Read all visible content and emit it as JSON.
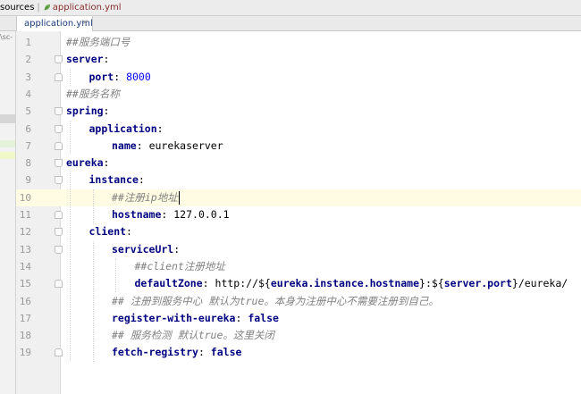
{
  "breadcrumb": {
    "items": [
      "sources",
      "application.yml"
    ]
  },
  "tab": {
    "label": "application.yml",
    "close": "×",
    "icon": "yml-leaf-icon"
  },
  "side_panel": {
    "path_text": "\\sc-"
  },
  "colors": {
    "key": "#000080",
    "comment": "#808080",
    "number": "#0000ff",
    "current_line": "#fffce3"
  },
  "editor": {
    "current_line": 10,
    "lines": [
      {
        "n": "1",
        "indent": 0,
        "parts": [
          {
            "t": "cmt",
            "v": "##服务端口号"
          }
        ]
      },
      {
        "n": "2",
        "indent": 0,
        "parts": [
          {
            "t": "key",
            "v": "server"
          },
          {
            "t": "punct",
            "v": ":"
          }
        ]
      },
      {
        "n": "3",
        "indent": 1,
        "parts": [
          {
            "t": "key",
            "v": "port"
          },
          {
            "t": "punct",
            "v": ": "
          },
          {
            "t": "num",
            "v": "8000"
          }
        ]
      },
      {
        "n": "4",
        "indent": 0,
        "parts": [
          {
            "t": "cmt",
            "v": "##服务名称"
          }
        ]
      },
      {
        "n": "5",
        "indent": 0,
        "parts": [
          {
            "t": "key",
            "v": "spring"
          },
          {
            "t": "punct",
            "v": ":"
          }
        ]
      },
      {
        "n": "6",
        "indent": 1,
        "parts": [
          {
            "t": "key",
            "v": "application"
          },
          {
            "t": "punct",
            "v": ":"
          }
        ]
      },
      {
        "n": "7",
        "indent": 2,
        "parts": [
          {
            "t": "key",
            "v": "name"
          },
          {
            "t": "punct",
            "v": ": "
          },
          {
            "t": "str",
            "v": "eurekaserver"
          }
        ]
      },
      {
        "n": "8",
        "indent": 0,
        "parts": [
          {
            "t": "key",
            "v": "eureka"
          },
          {
            "t": "punct",
            "v": ":"
          }
        ]
      },
      {
        "n": "9",
        "indent": 1,
        "parts": [
          {
            "t": "key",
            "v": "instance"
          },
          {
            "t": "punct",
            "v": ":"
          }
        ]
      },
      {
        "n": "10",
        "indent": 2,
        "parts": [
          {
            "t": "cmt",
            "v": "##注册ip地址"
          }
        ]
      },
      {
        "n": "11",
        "indent": 2,
        "parts": [
          {
            "t": "key",
            "v": "hostname"
          },
          {
            "t": "punct",
            "v": ": "
          },
          {
            "t": "str",
            "v": "127.0.0.1"
          }
        ]
      },
      {
        "n": "12",
        "indent": 1,
        "parts": [
          {
            "t": "key",
            "v": "client"
          },
          {
            "t": "punct",
            "v": ":"
          }
        ]
      },
      {
        "n": "13",
        "indent": 2,
        "parts": [
          {
            "t": "key",
            "v": "serviceUrl"
          },
          {
            "t": "punct",
            "v": ":"
          }
        ]
      },
      {
        "n": "14",
        "indent": 3,
        "parts": [
          {
            "t": "cmt",
            "v": "##client注册地址"
          }
        ]
      },
      {
        "n": "15",
        "indent": 3,
        "parts": [
          {
            "t": "key",
            "v": "defaultZone"
          },
          {
            "t": "punct",
            "v": ": "
          },
          {
            "t": "str",
            "v": "http://${"
          },
          {
            "t": "key",
            "v": "eureka.instance.hostname"
          },
          {
            "t": "str",
            "v": "}:${"
          },
          {
            "t": "key",
            "v": "server.port"
          },
          {
            "t": "str",
            "v": "}/eureka/"
          }
        ]
      },
      {
        "n": "16",
        "indent": 2,
        "parts": [
          {
            "t": "cmt",
            "v": "## 注册到服务中心 默认为true。本身为注册中心不需要注册到自己。"
          }
        ]
      },
      {
        "n": "17",
        "indent": 2,
        "parts": [
          {
            "t": "key",
            "v": "register-with-eureka"
          },
          {
            "t": "punct",
            "v": ": "
          },
          {
            "t": "key",
            "v": "false"
          }
        ]
      },
      {
        "n": "18",
        "indent": 2,
        "parts": [
          {
            "t": "cmt",
            "v": "## 服务检测 默认true。这里关闭"
          }
        ]
      },
      {
        "n": "19",
        "indent": 2,
        "parts": [
          {
            "t": "key",
            "v": "fetch-registry"
          },
          {
            "t": "punct",
            "v": ": "
          },
          {
            "t": "key",
            "v": "false"
          }
        ]
      }
    ]
  }
}
